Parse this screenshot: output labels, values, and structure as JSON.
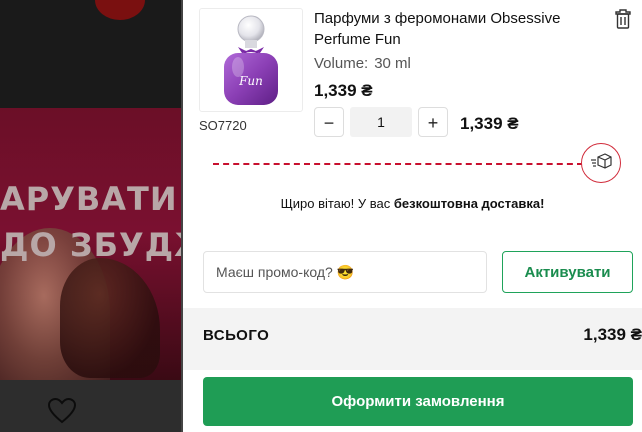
{
  "background_page": {
    "banner_line1": "АРУВАТИ К",
    "banner_line2": "ДО ЗБУДЖ"
  },
  "cart": {
    "item": {
      "name": "Парфуми з феромонами Obsessive Perfume Fun",
      "sku": "SO7720",
      "volume_label": "Volume:",
      "volume_value": "30 ml",
      "unit_price": "1,339 ₴",
      "quantity": "1",
      "line_total": "1,339 ₴",
      "image_label": "Fun",
      "minus_label": "−",
      "plus_label": "+"
    },
    "shipping_progress": {
      "fraction": 1.0,
      "message_prefix": "Щиро вітаю! У вас ",
      "message_bold": "безкоштовна доставка!"
    },
    "promo": {
      "placeholder": "Маєш промо-код? 😎",
      "button_label": "Активувати"
    },
    "total": {
      "label": "ВСЬОГО",
      "value": "1,339 ₴"
    },
    "checkout_label": "Оформити замовлення"
  },
  "colors": {
    "accent_green": "#1f9d55",
    "progress_red": "#c8102e",
    "perfume_purple": "#8b3fb5"
  },
  "icons": [
    "trash-icon",
    "delivery-box-icon",
    "heart-icon"
  ]
}
